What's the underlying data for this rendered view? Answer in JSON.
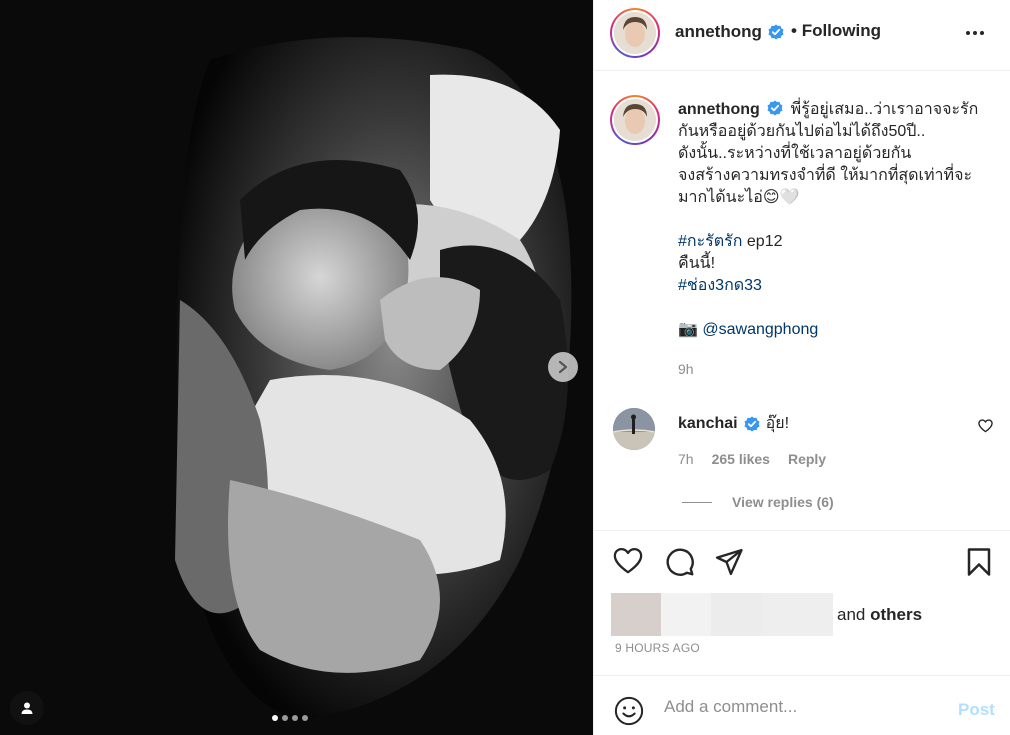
{
  "post": {
    "author": "annethong",
    "follow_status": "Following",
    "more_icon": "more-options-icon",
    "carousel": {
      "slide_count": 4,
      "active_slide": 1
    }
  },
  "caption": {
    "username": "annethong",
    "lines": [
      "พี่รู้อยู่เสมอ..ว่าเราอาจจะรัก",
      "กันหรืออยู่ด้วยกันไปต่อไม่ได้ถึง50ปี..",
      "ดังนั้น..ระหว่างที่ใช้เวลาอยู่ด้วยกัน",
      "จงสร้างความทรงจำที่ดี ให้มากที่สุดเท่าที่จะ",
      "มากได้นะไอ่😊🤍"
    ],
    "hashtag1": "#กะรัตรัก",
    "hashtag1_suffix": " ep12",
    "line_tonight": "คืนนี้!",
    "hashtag2": "#ช่อง3กด33",
    "camera_emoji": "📷",
    "photo_credit": "@sawangphong",
    "time": "9h"
  },
  "comment": {
    "username": "kanchai",
    "text": "อุ๊ย!",
    "time": "7h",
    "likes": "265 likes",
    "reply": "Reply",
    "view_replies": "View replies (6)"
  },
  "engagement": {
    "and_text": "and",
    "others_text": "others",
    "time_ago": "9 HOURS AGO"
  },
  "add_comment": {
    "placeholder": "Add a comment...",
    "post_label": "Post"
  },
  "colors": {
    "link": "#00376b",
    "verified": "#3897f0",
    "secondary_text": "#8e8e8e",
    "post_disabled": "#b2dffc"
  }
}
